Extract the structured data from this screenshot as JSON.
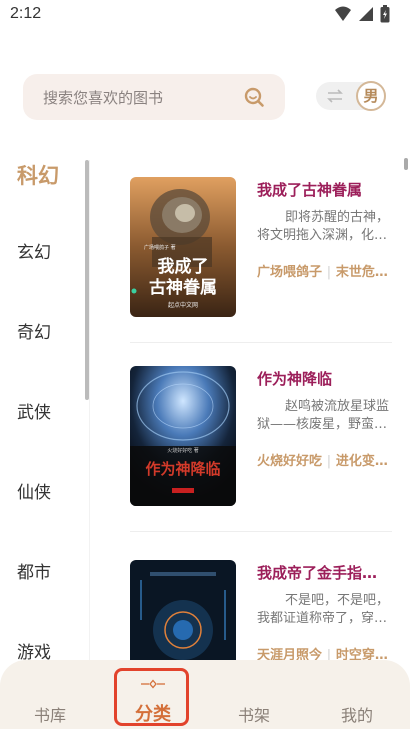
{
  "status_bar": {
    "time": "2:12"
  },
  "search": {
    "placeholder": "搜索您喜欢的图书"
  },
  "gender": {
    "label": "男"
  },
  "categories": [
    {
      "label": "科幻",
      "active": true
    },
    {
      "label": "玄幻"
    },
    {
      "label": "奇幻"
    },
    {
      "label": "武侠"
    },
    {
      "label": "仙侠"
    },
    {
      "label": "都市"
    },
    {
      "label": "游戏"
    }
  ],
  "books": [
    {
      "title": "我成了古神眷属",
      "desc_line1": "即将苏醒的古神，",
      "desc_line2": "将文明拖入深渊，化…",
      "author": "广场喂鸽子",
      "tag": "末世危…",
      "cover": {
        "title_line1": "我成了",
        "title_line2": "古神眷属",
        "publisher": "起点中文网",
        "author_small": "广场喂鸽子 著"
      }
    },
    {
      "title": "作为神降临",
      "desc_line1": "赵鸣被流放星球监",
      "desc_line2": "狱——核废星，野蛮…",
      "author": "火烧好好吃",
      "tag": "进化变…",
      "cover": {
        "title": "作为神降临",
        "author_small": "火烧好好吃 著"
      }
    },
    {
      "title": "我成帝了金手指…",
      "desc_line1": "不是吧，不是吧，",
      "desc_line2": "我都证道称帝了，穿…",
      "author": "天涯月照今",
      "tag": "时空穿…"
    }
  ],
  "nav": {
    "items": [
      {
        "label": "书库"
      },
      {
        "label": "分类",
        "active": true
      },
      {
        "label": "书架"
      },
      {
        "label": "我的"
      }
    ]
  },
  "colors": {
    "accent": "#c89a6a",
    "title": "#9c1f5a",
    "active_nav": "#d4703a",
    "highlight_frame": "#e2432c"
  }
}
